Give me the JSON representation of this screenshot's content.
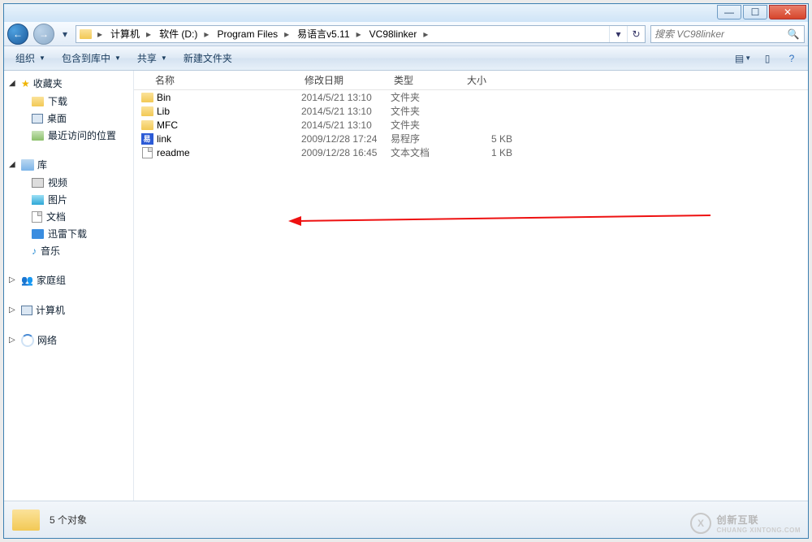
{
  "window_controls": {
    "min": "—",
    "max": "☐",
    "close": "✕"
  },
  "nav": {
    "back": "←",
    "forward": "→"
  },
  "breadcrumbs": [
    "计算机",
    "软件 (D:)",
    "Program Files",
    "易语言v5.11",
    "VC98linker"
  ],
  "address_refresh": "↻",
  "search": {
    "placeholder": "搜索 VC98linker",
    "icon": "🔍"
  },
  "toolbar": {
    "organize": "组织",
    "include": "包含到库中",
    "share": "共享",
    "newfolder": "新建文件夹"
  },
  "sidebar": {
    "favorites": {
      "label": "收藏夹",
      "items": [
        "下载",
        "桌面",
        "最近访问的位置"
      ]
    },
    "libraries": {
      "label": "库",
      "items": [
        "视频",
        "图片",
        "文档",
        "迅雷下载",
        "音乐"
      ]
    },
    "homegroup": {
      "label": "家庭组"
    },
    "computer": {
      "label": "计算机"
    },
    "network": {
      "label": "网络"
    }
  },
  "columns": {
    "name": "名称",
    "date": "修改日期",
    "type": "类型",
    "size": "大小"
  },
  "rows": [
    {
      "icon": "folder",
      "name": "Bin",
      "date": "2014/5/21 13:10",
      "type": "文件夹",
      "size": ""
    },
    {
      "icon": "folder",
      "name": "Lib",
      "date": "2014/5/21 13:10",
      "type": "文件夹",
      "size": ""
    },
    {
      "icon": "folder",
      "name": "MFC",
      "date": "2014/5/21 13:10",
      "type": "文件夹",
      "size": ""
    },
    {
      "icon": "link",
      "name": "link",
      "date": "2009/12/28 17:24",
      "type": "易程序",
      "size": "5 KB"
    },
    {
      "icon": "file",
      "name": "readme",
      "date": "2009/12/28 16:45",
      "type": "文本文档",
      "size": "1 KB"
    }
  ],
  "status": {
    "count": "5 个对象"
  },
  "watermark": {
    "main": "创新互联",
    "sub": "CHUANG XINTONG.COM"
  }
}
